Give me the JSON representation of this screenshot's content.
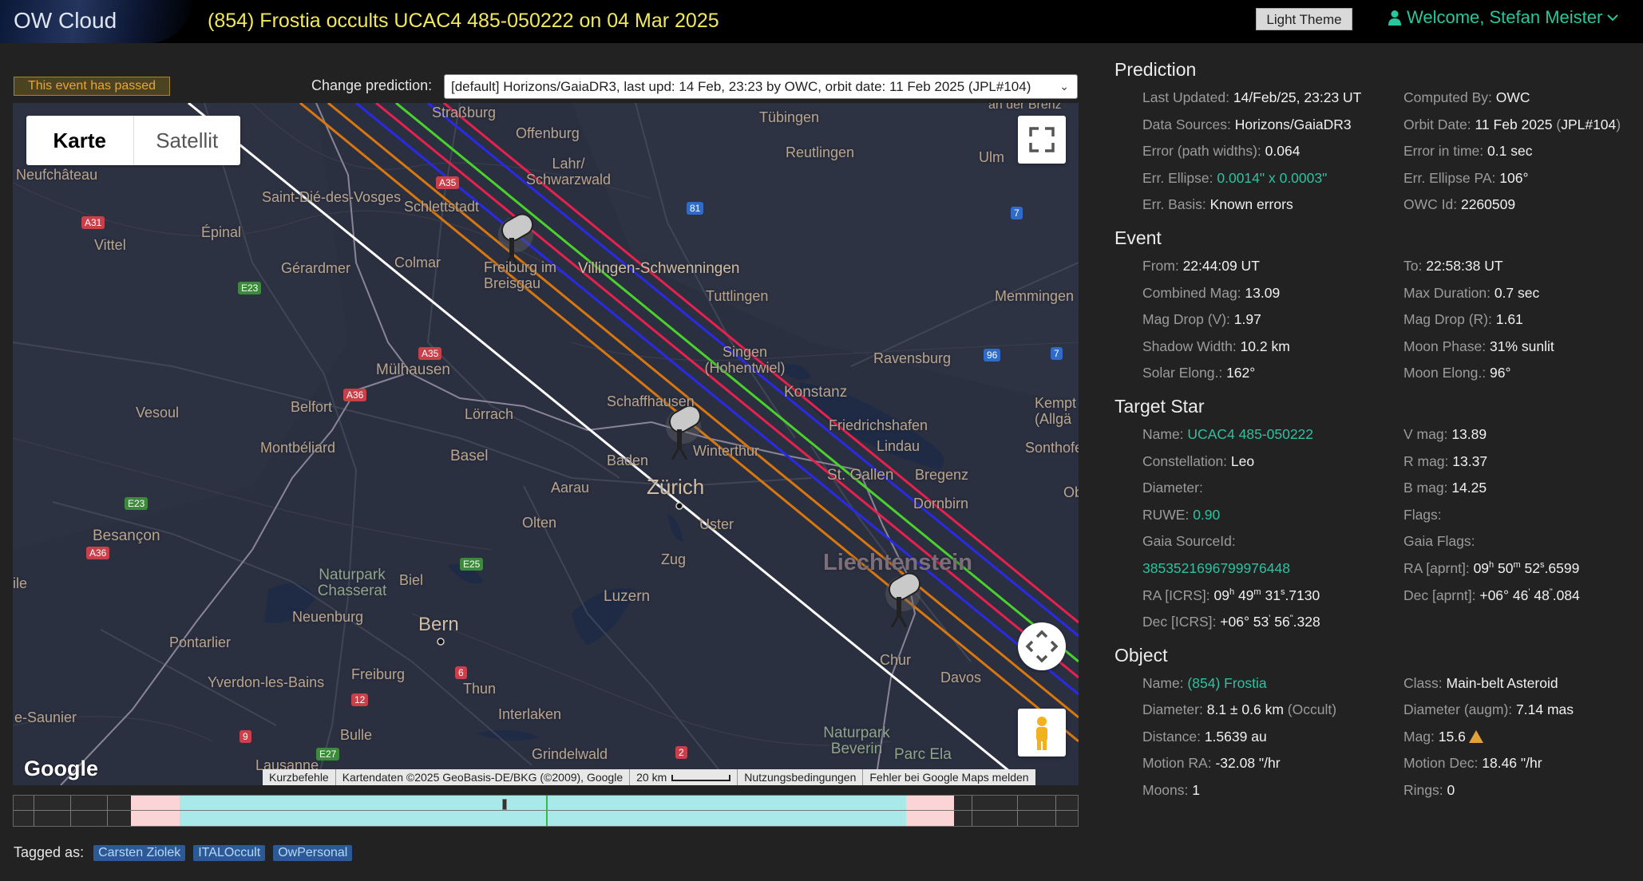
{
  "header": {
    "logo": "OW Cloud",
    "title": "(854) Frostia occults UCAC4 485-050222 on 04 Mar 2025",
    "theme_button": "Light Theme",
    "welcome": "Welcome, Stefan Meister"
  },
  "status": {
    "passed": "This event has passed"
  },
  "prediction_select": {
    "label": "Change prediction:",
    "value": "[default] Horizons/GaiaDR3, last upd: 14 Feb, 23:23 by OWC, orbit date: 11 Feb 2025 (JPL#104)"
  },
  "map": {
    "type_buttons": [
      "Karte",
      "Satellit"
    ],
    "google_logo": "Google",
    "attribution": {
      "shortcuts": "Kurzbefehle",
      "data": "Kartendaten ©2025 GeoBasis-DE/BKG (©2009), Google",
      "scale": "20 km",
      "terms": "Nutzungsbedingungen",
      "report": "Fehler bei Google Maps melden"
    },
    "places": [
      "Straßburg",
      "Offenburg",
      "Tübingen",
      "Reutlingen",
      "Ulm",
      "an der Brenz",
      "Neufchâteau",
      "Lahr/ Schwarzwald",
      "Saint-Dié-des-Vosges",
      "Schlettstadt",
      "Épinal",
      "Vittel",
      "Gérardmer",
      "Colmar",
      "Freiburg im Breisgau",
      "Villingen-Schwenningen",
      "Tuttlingen",
      "Memmingen",
      "Singen (Hohentwiel)",
      "Ravensburg",
      "Mülhausen",
      "Belfort",
      "Lörrach",
      "Schaffhausen",
      "Konstanz",
      "Friedrichshafen",
      "Kempt (Allgä",
      "Vesoul",
      "Montbéliard",
      "Basel",
      "Baden",
      "Winterthur",
      "Lindau",
      "Sonthofe",
      "Aarau",
      "Zürich",
      "St. Gallen",
      "Bregenz",
      "Dornbirn",
      "Olten",
      "Uster",
      "Besançon",
      "Zug",
      "Liechtenstein",
      "Naturpark Chasserat",
      "Biel",
      "Neuenburg",
      "Bern",
      "Luzern",
      "Pontarlier",
      "Freiburg",
      "Thun",
      "Chur",
      "Davos",
      "Yverdon-les-Bains",
      "Interlaken",
      "e-Saunier",
      "Bulle",
      "Grindelwald",
      "Naturpark Beverin",
      "Parc Ela",
      "Lausanne",
      "ile",
      "Ob"
    ],
    "roads": [
      "A31",
      "A35",
      "A36",
      "A35",
      "81",
      "7",
      "E23",
      "96",
      "7",
      "E23",
      "A36",
      "E25",
      "6",
      "12",
      "9",
      "E27",
      "2"
    ]
  },
  "tags": {
    "label": "Tagged as:",
    "items": [
      "Carsten Ziolek",
      "ITALOccult",
      "OwPersonal"
    ]
  },
  "prediction": {
    "title": "Prediction",
    "last_updated_k": "Last Updated:",
    "last_updated_v": "14/Feb/25, 23:23 UT",
    "computed_by_k": "Computed By:",
    "computed_by_v": "OWC",
    "data_sources_k": "Data Sources:",
    "data_sources_v": "Horizons/GaiaDR3",
    "orbit_date_k": "Orbit Date:",
    "orbit_date_v": "11 Feb 2025",
    "orbit_ref_open": "(",
    "orbit_ref": "JPL#104",
    "orbit_ref_close": ")",
    "err_path_k": "Error (path widths):",
    "err_path_v": "0.064",
    "err_time_k": "Error in time:",
    "err_time_v": "0.1 sec",
    "err_ellipse_k": "Err. Ellipse:",
    "err_ellipse_v": "0.0014\" x 0.0003\"",
    "err_ellipse_pa_k": "Err. Ellipse PA:",
    "err_ellipse_pa_v": "106°",
    "err_basis_k": "Err. Basis:",
    "err_basis_v": "Known errors",
    "owc_id_k": "OWC Id:",
    "owc_id_v": "2260509"
  },
  "event": {
    "title": "Event",
    "from_k": "From:",
    "from_v": "22:44:09 UT",
    "to_k": "To:",
    "to_v": "22:58:38 UT",
    "comb_mag_k": "Combined Mag:",
    "comb_mag_v": "13.09",
    "max_dur_k": "Max Duration:",
    "max_dur_v": "0.7 sec",
    "mag_drop_v_k": "Mag Drop (V):",
    "mag_drop_v_v": "1.97",
    "mag_drop_r_k": "Mag Drop (R):",
    "mag_drop_r_v": "1.61",
    "shadow_k": "Shadow Width:",
    "shadow_v": "10.2 km",
    "moon_phase_k": "Moon Phase:",
    "moon_phase_v": "31% sunlit",
    "solar_elong_k": "Solar Elong.:",
    "solar_elong_v": "162°",
    "moon_elong_k": "Moon Elong.:",
    "moon_elong_v": "96°"
  },
  "star": {
    "title": "Target Star",
    "name_k": "Name:",
    "name_v": "UCAC4 485-050222",
    "vmag_k": "V mag:",
    "vmag_v": "13.89",
    "const_k": "Constellation:",
    "const_v": "Leo",
    "rmag_k": "R mag:",
    "rmag_v": "13.37",
    "diam_k": "Diameter:",
    "bmag_k": "B mag:",
    "bmag_v": "14.25",
    "ruwe_k": "RUWE:",
    "ruwe_v": "0.90",
    "flags_k": "Flags:",
    "gaia_id_k": "Gaia SourceId:",
    "gaia_flags_k": "Gaia Flags:",
    "gaia_id_v": "3853521696799976448",
    "ra_aprnt_k": "RA [aprnt]:",
    "ra_aprnt_h": "09",
    "ra_aprnt_m": "50",
    "ra_aprnt_s": "52",
    "ra_aprnt_f": ".6599",
    "ra_icrs_k": "RA [ICRS]:",
    "ra_icrs_h": "09",
    "ra_icrs_m": "49",
    "ra_icrs_s": "31",
    "ra_icrs_f": ".7130",
    "dec_aprnt_k": "Dec [aprnt]:",
    "dec_aprnt_d": "+06° 46",
    "dec_aprnt_s": "48",
    "dec_aprnt_f": ".084",
    "dec_icrs_k": "Dec [ICRS]:",
    "dec_icrs_d": "+06° 53",
    "dec_icrs_s": "56",
    "dec_icrs_f": ".328",
    "unit_h": "h",
    "unit_m": "m",
    "unit_s": "s",
    "unit_am": "'",
    "unit_as": "\""
  },
  "object": {
    "title": "Object",
    "name_k": "Name:",
    "name_v": "(854) Frostia",
    "class_k": "Class:",
    "class_v": "Main-belt Asteroid",
    "diam_k": "Diameter:",
    "diam_v": "8.1 ± 0.6 km",
    "diam_src": "(Occult)",
    "diam_augm_k": "Diameter (augm):",
    "diam_augm_v": "7.14 mas",
    "dist_k": "Distance:",
    "dist_v": "1.5639 au",
    "mag_k": "Mag:",
    "mag_v": "15.6",
    "mra_k": "Motion RA:",
    "mra_v": "-32.08 \"/hr",
    "mdec_k": "Motion Dec:",
    "mdec_v": "18.46 \"/hr",
    "moons_k": "Moons:",
    "moons_v": "1",
    "rings_k": "Rings:",
    "rings_v": "0"
  },
  "colors": {
    "title_yellow": "#f1e85a",
    "accent_teal": "#2ec1a0",
    "path_red": "#e8204f",
    "path_blue": "#2a2ae6",
    "path_green": "#4ad12a",
    "path_orange": "#d8760f",
    "path_white": "#ffffff",
    "timeline_cyan": "#a9e9ea",
    "timeline_pink": "#fbd5d5"
  },
  "timeline": {
    "fraction_pink_start": 0.11,
    "fraction_cyan_start": 0.156,
    "fraction_cyan_end": 0.839,
    "fraction_pink_end": 0.884,
    "fraction_marker": 0.459,
    "fraction_green": 0.5
  }
}
